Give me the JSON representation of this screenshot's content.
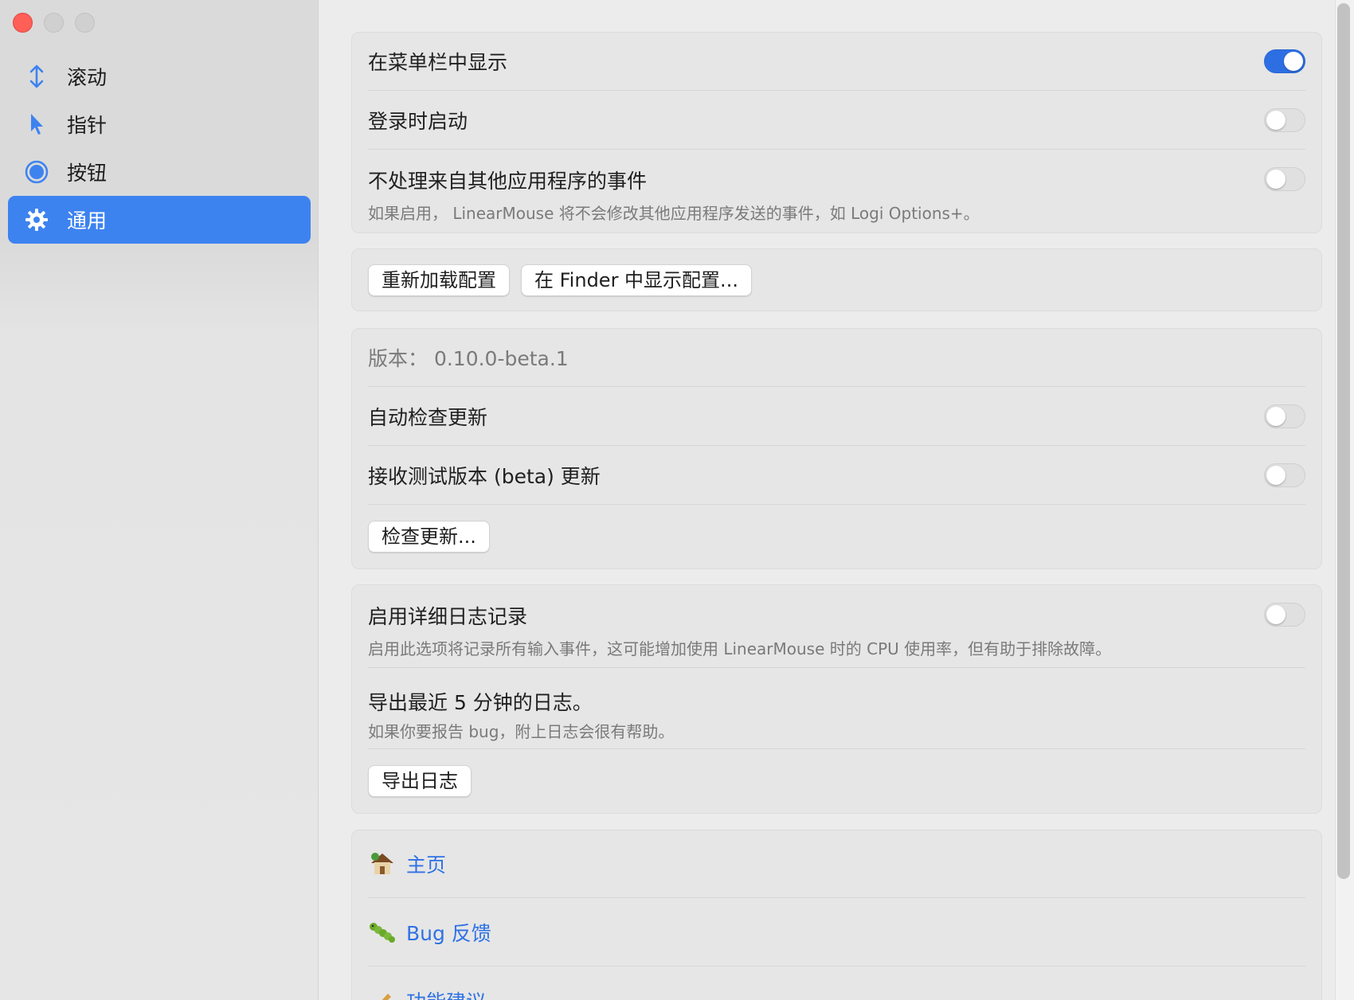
{
  "sidebar": {
    "items": [
      {
        "label": "滚动",
        "icon": "scroll-arrows-icon",
        "active": false
      },
      {
        "label": "指针",
        "icon": "pointer-arrow-icon",
        "active": false
      },
      {
        "label": "按钮",
        "icon": "button-circle-icon",
        "active": false
      },
      {
        "label": "通用",
        "icon": "gear-icon",
        "active": true
      }
    ]
  },
  "general": {
    "menubar_label": "在菜单栏中显示",
    "menubar_on": true,
    "login_label": "登录时启动",
    "login_on": false,
    "ignore_label": "不处理来自其他应用程序的事件",
    "ignore_desc": "如果启用， LinearMouse 将不会修改其他应用程序发送的事件，如 Logi Options+。",
    "ignore_on": false
  },
  "config": {
    "reload_label": "重新加载配置",
    "reveal_label": "在 Finder 中显示配置..."
  },
  "update": {
    "version_text": "版本： 0.10.0-beta.1",
    "auto_check_label": "自动检查更新",
    "auto_check_on": false,
    "beta_label": "接收测试版本 (beta) 更新",
    "beta_on": false,
    "check_button": "检查更新..."
  },
  "logging": {
    "verbose_label": "启用详细日志记录",
    "verbose_desc": "启用此选项将记录所有输入事件，这可能增加使用 LinearMouse 时的 CPU 使用率，但有助于排除故障。",
    "verbose_on": false,
    "export_title": "导出最近 5 分钟的日志。",
    "export_desc": "如果你要报告 bug，附上日志会很有帮助。",
    "export_button": "导出日志"
  },
  "links": {
    "homepage": "主页",
    "bug_report": "Bug 反馈",
    "feature_request": "功能建议"
  },
  "colors": {
    "accent": "#3d83f0",
    "link": "#2f72e4",
    "toggle_on": "#2d6fe3"
  }
}
